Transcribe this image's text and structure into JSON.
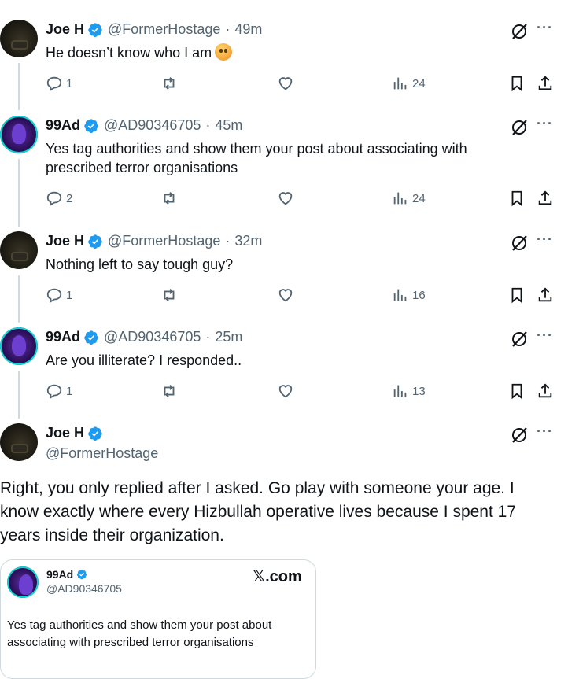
{
  "tweets": [
    {
      "name": "Joe H",
      "handle": "@FormerHostage",
      "time": "49m",
      "text": "He doesn’t know who I am",
      "replies": "1",
      "views": "24"
    },
    {
      "name": "99Ad",
      "handle": "@AD90346705",
      "time": "45m",
      "text": "Yes tag authorities and show them your post about associating with prescribed terror organisations",
      "replies": "2",
      "views": "24"
    },
    {
      "name": "Joe H",
      "handle": "@FormerHostage",
      "time": "32m",
      "text": "Nothing left to say tough guy?",
      "replies": "1",
      "views": "16"
    },
    {
      "name": "99Ad",
      "handle": "@AD90346705",
      "time": "25m",
      "text": "Are you illiterate? I responded..",
      "replies": "1",
      "views": "13"
    }
  ],
  "main": {
    "name": "Joe H",
    "handle": "@FormerHostage",
    "text": "Right, you only replied after I asked.  Go play with someone your age.  I know exactly where every Hizbullah operative lives because I spent 17 years inside their organization."
  },
  "quote": {
    "name": "99Ad",
    "handle": "@AD90346705",
    "logo": "𝕏.com",
    "text": "Yes tag authorities and show them your post about associating with prescribed terror organisations"
  },
  "separator": "·",
  "more_glyph": "···",
  "colors": {
    "verified": "#1d9bf0",
    "text": "#0f1419",
    "secondary": "#536471",
    "line": "#cfd9de"
  }
}
